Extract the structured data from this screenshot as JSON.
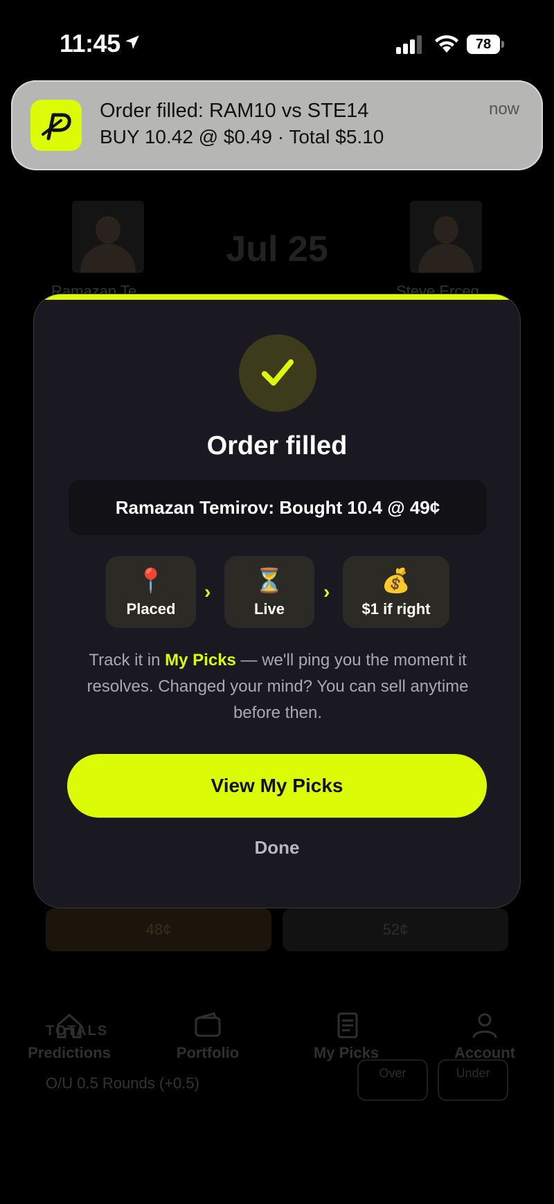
{
  "status_bar": {
    "time": "11:45",
    "battery": "78"
  },
  "notification": {
    "title": "Order filled: RAM10 vs STE14",
    "body": "BUY 10.42 @ $0.49 · Total $5.10",
    "time": "now"
  },
  "background": {
    "date": "Jul 25",
    "fighter_left": "Ramazan Te",
    "fighter_right": "Steve Erceg",
    "price_left": "48¢",
    "price_right": "52¢",
    "totals_header": "TOTALS",
    "ou_label": "O/U 0.5 Rounds  (+0.5)",
    "over_label": "Over",
    "under_label": "Under"
  },
  "tabs": [
    {
      "label": "Predictions",
      "icon": "home-icon"
    },
    {
      "label": "Portfolio",
      "icon": "wallet-icon"
    },
    {
      "label": "My Picks",
      "icon": "receipt-icon"
    },
    {
      "label": "Account",
      "icon": "person-icon"
    }
  ],
  "modal": {
    "title": "Order filled",
    "summary": "Ramazan Temirov: Bought 10.4 @ 49¢",
    "steps": [
      {
        "emoji": "📍",
        "label": "Placed"
      },
      {
        "emoji": "⏳",
        "label": "Live"
      },
      {
        "emoji": "💰",
        "label": "$1 if right"
      }
    ],
    "arrow": "›",
    "info_pre": "Track it in ",
    "info_link": "My Picks",
    "info_post": " — we'll ping you the moment it resolves. Changed your mind? You can sell anytime before then.",
    "cta_label": "View My Picks",
    "done_label": "Done"
  },
  "colors": {
    "accent": "#dcfb07",
    "modal_bg": "#1a1821",
    "background": "#000000"
  }
}
